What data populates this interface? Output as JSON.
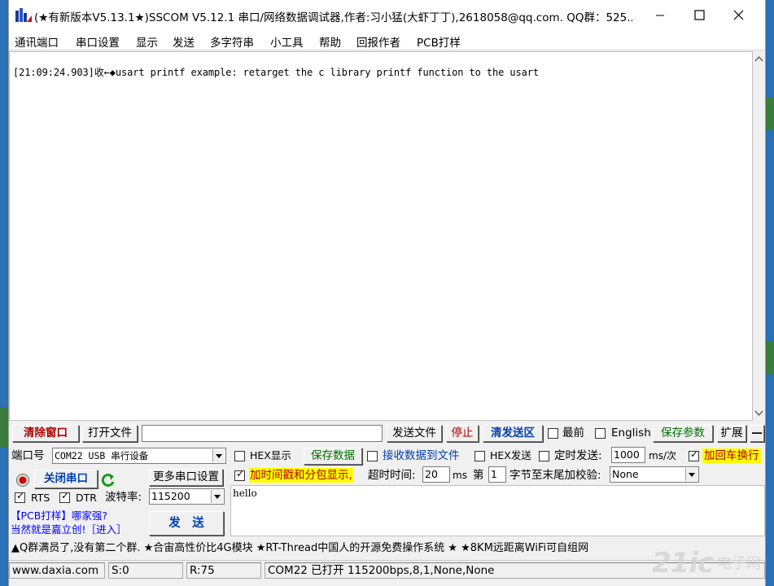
{
  "window": {
    "title": "(★有新版本V5.13.1★)SSCOM V5.12.1 串口/网络数据调试器,作者:习小猛(大虾丁丁),2618058@qq.com. QQ群：525...",
    "minimize_label": "—",
    "maximize_label": "☐",
    "close_label": "✕"
  },
  "menu": [
    "通讯端口",
    "串口设置",
    "显示",
    "发送",
    "多字符串",
    "小工具",
    "帮助",
    "回报作者",
    "PCB打样"
  ],
  "receive": {
    "line": "[21:09:24.903]收←◆usart printf example: retarget the c library printf function to the usart"
  },
  "toolbar": {
    "clear_button": "清除窗口",
    "open_file_button": "打开文件",
    "file_path_value": "",
    "send_file_button": "发送文件",
    "stop_button": "停止",
    "clear_send_button": "清发送区",
    "topmost_label": "最前",
    "english_label": "English",
    "save_params_button": "保存参数",
    "expand_button": "扩展",
    "collapse_button": "—"
  },
  "port": {
    "port_label": "端口号",
    "port_value": "COM22 USB 串行设备",
    "close_port_button": "关闭串口",
    "more_settings_button": "更多串口设置",
    "rts_label": "RTS",
    "dtr_label": "DTR",
    "baud_label": "波特率:",
    "baud_value": "115200"
  },
  "display_opts": {
    "hex_display_label": "HEX显示",
    "save_data_button": "保存数据",
    "recv_to_file_label": "接收数据到文件",
    "timestamp_label": "加时间戳和分包显示,",
    "timeout_label": "超时时间:",
    "timeout_value": "20",
    "timeout_unit": "ms",
    "byte_label_prefix": "第",
    "byte_value": "1",
    "byte_label_suffix": "字节至末尾加校验:",
    "checksum_value": "None"
  },
  "send_opts": {
    "hex_send_label": "HEX发送",
    "timed_send_label": "定时发送:",
    "interval_value": "1000",
    "interval_unit": "ms/次",
    "add_crlf_label": "加回车换行"
  },
  "promo": {
    "line1": "【PCB打样】哪家强?",
    "line2": "当然就是嘉立创!［进入］"
  },
  "send": {
    "button": "发　送",
    "text": "hello"
  },
  "banner": "▲Q群满员了,没有第二个群. ★合宙高性价比4G模块 ★RT-Thread中国人的开源免费操作系统 ★ ★8KM远距离WiFi可自组网",
  "status": {
    "website": "www.daxia.com",
    "sent": "S:0",
    "received": "R:75",
    "port_state": "COM22 已打开  115200bps,8,1,None,None"
  },
  "watermark": {
    "text1": "21ic",
    "text2": "电子网"
  },
  "colors": {
    "accent_red": "#b00000",
    "link_blue": "#0000ff",
    "save_green": "#007000",
    "highlight_yellow": "#ffff00"
  }
}
